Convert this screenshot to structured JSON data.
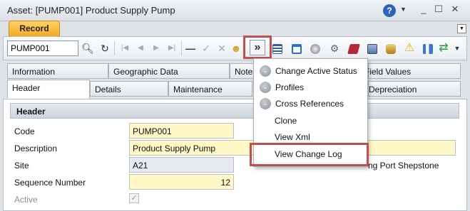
{
  "window": {
    "title": "Asset: [PUMP001] Product Supply Pump",
    "help_icon": "help-icon",
    "minimize": "_",
    "maximize": "☐",
    "close": "✕"
  },
  "record_tab": "Record",
  "toolbar": {
    "record_value": "PUMP001",
    "more_label": "»"
  },
  "tabs_row1": [
    "Information",
    "Geographic Data",
    "Notes",
    "Field Values"
  ],
  "tabs_row2": [
    "Header",
    "Details",
    "Maintenance",
    "Depreciation"
  ],
  "menu": {
    "items": [
      "Change Active Status",
      "Profiles",
      "Cross References",
      "Clone",
      "View Xml",
      "View Change Log"
    ]
  },
  "form": {
    "section_title": "Header",
    "code_label": "Code",
    "code_value": "PUMP001",
    "description_label": "Description",
    "description_value": "Product Supply Pump",
    "site_label": "Site",
    "site_value": "A21",
    "site_name_fragment": "ng Port Shepstone",
    "sequence_label": "Sequence Number",
    "sequence_value": "12",
    "active_label": "Active",
    "active_checked": true
  },
  "colors": {
    "highlight": "#c0504d",
    "required_field": "#fff8c6",
    "record_tab": "#f3aa24"
  }
}
